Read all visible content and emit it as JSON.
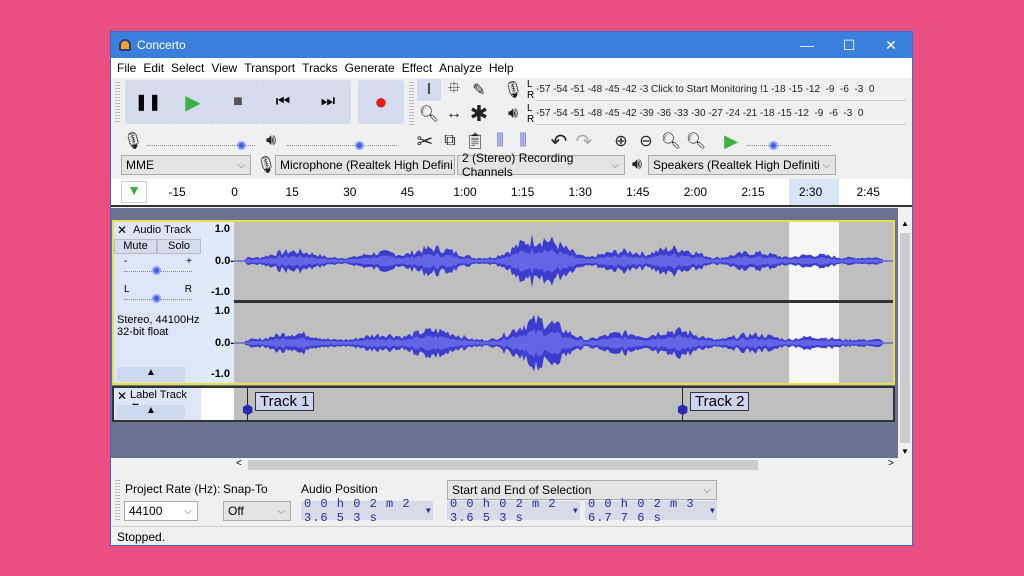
{
  "window": {
    "title": "Concerto",
    "minimize": "—",
    "maximize": "☐",
    "close": "✕"
  },
  "menu": [
    "File",
    "Edit",
    "Select",
    "View",
    "Transport",
    "Tracks",
    "Generate",
    "Effect",
    "Analyze",
    "Help"
  ],
  "transport": {
    "pause": "❚❚",
    "play": "▶",
    "stop": "■",
    "skip_start": "⏮",
    "skip_end": "⏭",
    "record": "●"
  },
  "meters": {
    "record_scale": "-57 -54 -51 -48 -45 -42 -3 Click to Start Monitoring !1 -18 -15 -12  -9  -6  -3  0",
    "playback_scale": "-57 -54 -51 -48 -45 -42 -39 -36 -33 -30 -27 -24 -21 -18 -15 -12  -9  -6  -3  0",
    "channel_l": "L",
    "channel_r": "R"
  },
  "devices": {
    "host": "MME",
    "microphone": "Microphone (Realtek High Defini",
    "channels": "2 (Stereo) Recording Channels",
    "speakers": "Speakers (Realtek High Definiti"
  },
  "ruler": {
    "labels": [
      "-15",
      "0",
      "15",
      "30",
      "45",
      "1:00",
      "1:15",
      "1:30",
      "1:45",
      "2:00",
      "2:15",
      "2:30",
      "2:45"
    ]
  },
  "audio_track": {
    "name": "Audio Track",
    "mute": "Mute",
    "solo": "Solo",
    "gain_minus": "-",
    "gain_plus": "+",
    "pan_l": "L",
    "pan_r": "R",
    "info1": "Stereo, 44100Hz",
    "info2": "32-bit float",
    "scale": [
      "1.0",
      "0.0-",
      "-1.0"
    ],
    "gain_value": 0.6,
    "pan_value": 0.5
  },
  "label_track": {
    "name": "Label Track",
    "labels": [
      "Track 1",
      "Track 2"
    ]
  },
  "selection_toolbar": {
    "rate_label": "Project Rate (Hz):",
    "rate_value": "44100",
    "snap_label": "Snap-To",
    "snap_value": "Off",
    "position_label": "Audio Position",
    "position_value": "0 0 h 0 2 m 2 3.6 5 3 s",
    "selection_mode": "Start and End of Selection",
    "start_value": "0 0 h 0 2 m 2 3.6 5 3 s",
    "end_value": "0 0 h 0 2 m 3 6.7 7 6 s"
  },
  "status": "Stopped.",
  "colors": {
    "titlebar": "#3b7fdc",
    "waveform": "#3c3ccf",
    "selection": "#ffffff",
    "track_border": "#e8e04a"
  }
}
